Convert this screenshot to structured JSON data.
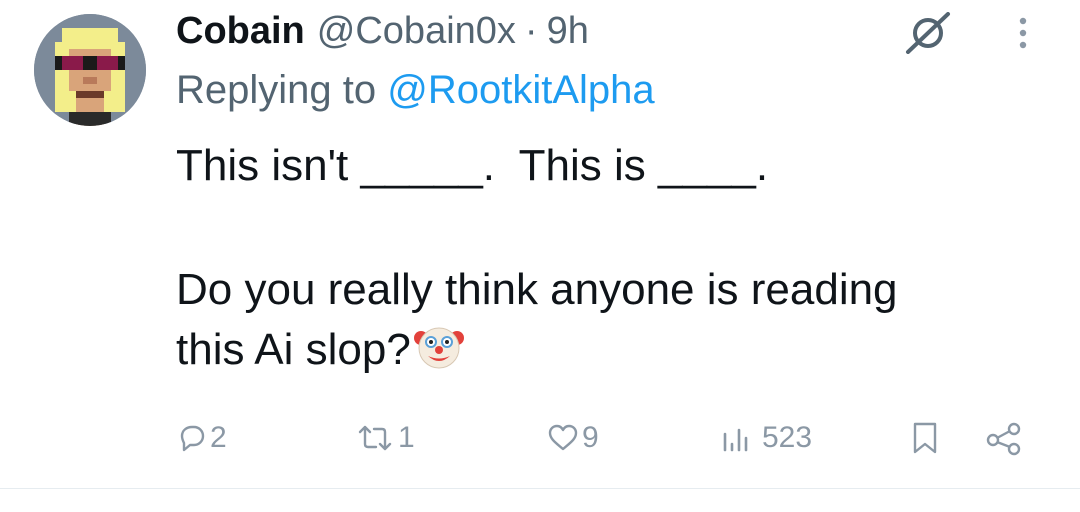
{
  "tweet": {
    "author": {
      "display_name": "Cobain",
      "handle": "@Cobain0x",
      "avatar_icon": "pixel-art-avatar-blonde-sunglasses"
    },
    "separator": "·",
    "timestamp": "9h",
    "reply_prefix": "Replying to",
    "reply_to": "@RootkitAlpha",
    "text_lines": [
      "This isn't _____.  This is ____.",
      "Do you really think anyone is reading",
      "this Ai slop?"
    ],
    "emoji": "clown-face",
    "actions": {
      "replies": "2",
      "reposts": "1",
      "likes": "9",
      "views": "523"
    },
    "icons": [
      "grok-icon",
      "more-icon",
      "reply-icon",
      "repost-icon",
      "like-icon",
      "views-icon",
      "bookmark-icon",
      "share-icon"
    ]
  },
  "colors": {
    "text_primary": "#0f1419",
    "text_secondary": "#536471",
    "link": "#1d9bf0",
    "action_icon": "#8b98a5"
  }
}
